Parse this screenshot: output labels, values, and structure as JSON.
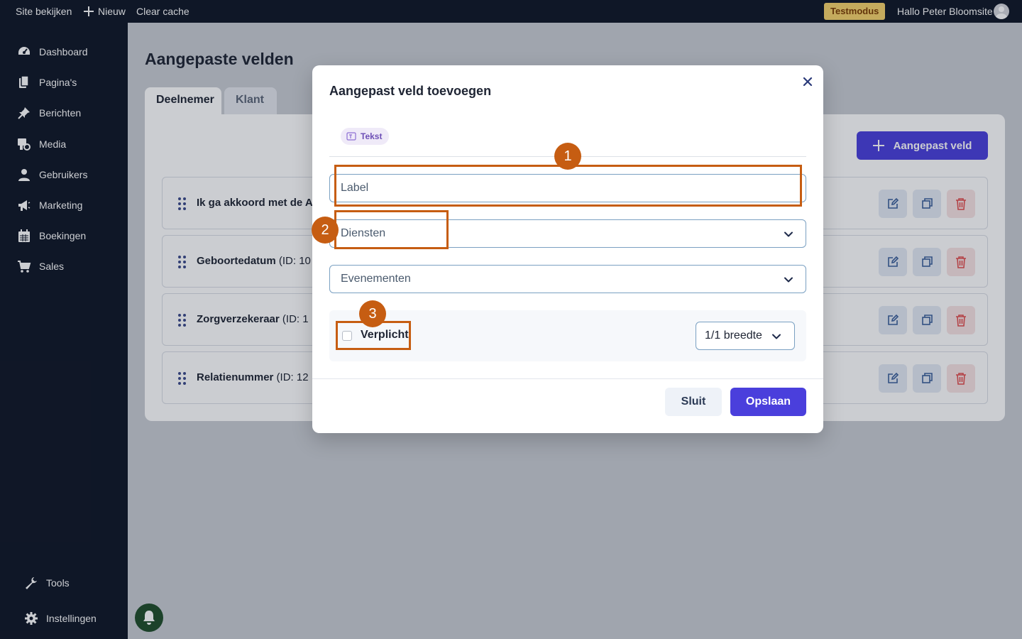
{
  "topbar": {
    "site_link": "Site bekijken",
    "new_label": "Nieuw",
    "clear_cache": "Clear cache",
    "test_badge": "Testmodus",
    "greeting": "Hallo Peter Bloomsite"
  },
  "sidebar": {
    "items": [
      {
        "label": "Dashboard",
        "icon": "dashboard-icon"
      },
      {
        "label": "Pagina's",
        "icon": "pages-icon"
      },
      {
        "label": "Berichten",
        "icon": "pin-icon"
      },
      {
        "label": "Media",
        "icon": "media-icon"
      },
      {
        "label": "Gebruikers",
        "icon": "user-icon"
      },
      {
        "label": "Marketing",
        "icon": "megaphone-icon"
      },
      {
        "label": "Boekingen",
        "icon": "calendar-icon"
      },
      {
        "label": "Sales",
        "icon": "cart-icon"
      }
    ],
    "bottom": [
      {
        "label": "Tools",
        "icon": "wrench-icon"
      },
      {
        "label": "Instellingen",
        "icon": "gear-icon"
      }
    ]
  },
  "main": {
    "title": "Aangepaste velden",
    "tabs": [
      "Deelnemer",
      "Klant"
    ],
    "add_button": "Aangepast veld",
    "rows": [
      {
        "name": "Ik ga akkoord met de A",
        "id": ""
      },
      {
        "name": "Geboortedatum",
        "id": "(ID: 10"
      },
      {
        "name": "Zorgverzekeraar",
        "id": "(ID: 1"
      },
      {
        "name": "Relatienummer",
        "id": "(ID: 12"
      }
    ]
  },
  "modal": {
    "title": "Aangepast veld toevoegen",
    "chip": "Tekst",
    "label_placeholder": "Label",
    "services_placeholder": "Diensten",
    "events_placeholder": "Evenementen",
    "required_label": "Verplicht",
    "required_checked": false,
    "width_value": "1/1 breedte",
    "close_button": "Sluit",
    "save_button": "Opslaan"
  },
  "annotations": [
    "1",
    "2",
    "3"
  ],
  "colors": {
    "primary": "#4a3fdc",
    "sidebar_bg": "#0f1626",
    "annotation": "#c65d12",
    "test_badge": "#f6d36b"
  }
}
